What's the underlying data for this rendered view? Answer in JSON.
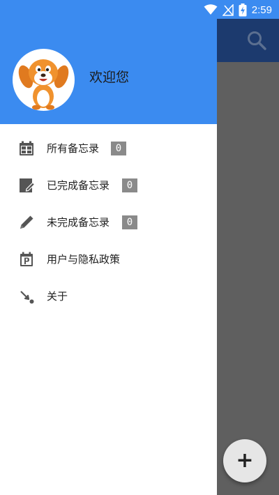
{
  "status_bar": {
    "time": "2:59"
  },
  "drawer": {
    "welcome_text": "欢迎您",
    "items": [
      {
        "label": "所有备忘录",
        "badge": "0",
        "icon": "calendar-grid-icon"
      },
      {
        "label": "已完成备忘录",
        "badge": "0",
        "icon": "note-edit-icon"
      },
      {
        "label": "未完成备忘录",
        "badge": "0",
        "icon": "pencil-icon"
      },
      {
        "label": "用户与隐私政策",
        "icon": "calendar-p-icon"
      },
      {
        "label": "关于",
        "icon": "arrow-dot-icon"
      }
    ]
  },
  "fab": {
    "label": "+"
  },
  "colors": {
    "header_blue": "#3b8bf0",
    "background_toolbar": "#1c3a6e",
    "badge_gray": "#8a8a8a"
  }
}
